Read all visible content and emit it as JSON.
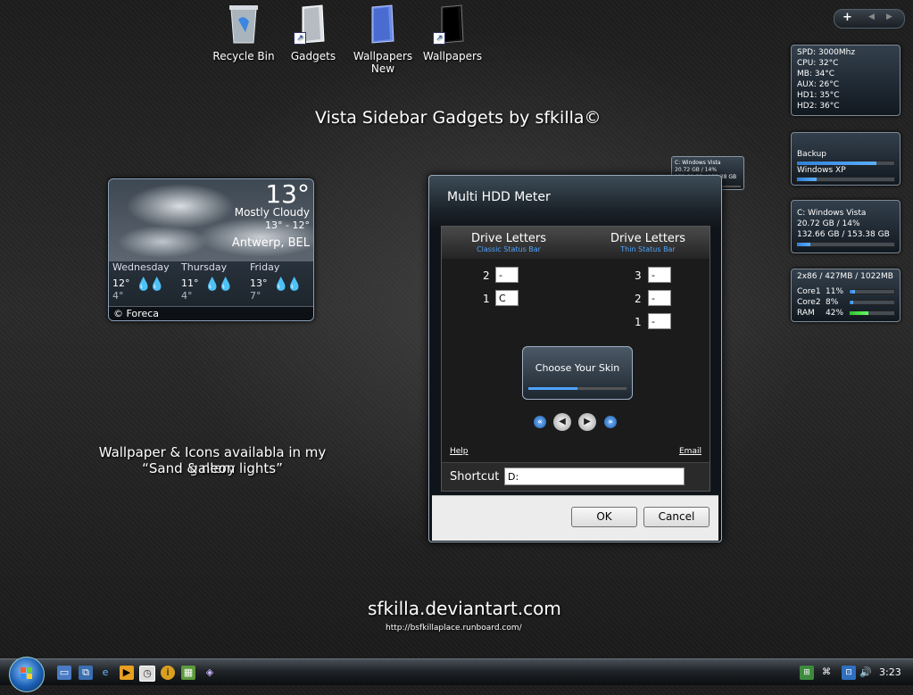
{
  "desktop_icons": [
    {
      "label": "Recycle Bin",
      "icon": "recycle-bin-icon"
    },
    {
      "label": "Gadgets",
      "icon": "folder-shortcut-icon"
    },
    {
      "label": "Wallpapers New",
      "icon": "folder-icon"
    },
    {
      "label": "Wallpapers",
      "icon": "folder-shortcut-icon"
    }
  ],
  "wallpaper": {
    "heading": "Vista Sidebar Gadgets by sfkilla©",
    "gallery_line1": "Wallpaper & Icons availabla in my gallery",
    "gallery_line2": "“Sand & neon lights”",
    "site": "sfkilla.deviantart.com",
    "url": "http://bsfkillaplace.runboard.com/"
  },
  "weather": {
    "temp": "13°",
    "condition": "Mostly Cloudy",
    "range": "13° - 12°",
    "city": "Antwerp, BEL",
    "days": [
      {
        "name": "Wednesday",
        "hi": "12°",
        "lo": "4°"
      },
      {
        "name": "Thursday",
        "hi": "11°",
        "lo": "4°"
      },
      {
        "name": "Friday",
        "hi": "13°",
        "lo": "7°"
      }
    ],
    "footer": "© Foreca"
  },
  "dialog": {
    "title": "Multi HDD Meter",
    "left_heading": "Drive Letters",
    "left_sub": "Classic Status Bar",
    "right_heading": "Drive Letters",
    "right_sub": "Thin Status Bar",
    "left_rows": [
      {
        "num": "2",
        "value": "-"
      },
      {
        "num": "1",
        "value": "C"
      }
    ],
    "right_rows": [
      {
        "num": "3",
        "value": "-"
      },
      {
        "num": "2",
        "value": "-"
      },
      {
        "num": "1",
        "value": "-"
      }
    ],
    "skin_button": "Choose Your Skin",
    "help": "Help",
    "email": "Email",
    "shortcut_label": "Shortcut",
    "shortcut_value": "D:",
    "ok": "OK",
    "cancel": "Cancel"
  },
  "mini_hdd": {
    "line1": "C: Windows Vista",
    "line2": "20.72 GB / 14%",
    "line3": "132.66 GB / 153.38 GB"
  },
  "sidebar": {
    "temps": [
      "SPD: 3000Mhz",
      "CPU:  32°C",
      "MB:   34°C",
      "AUX:  26°C",
      "HD1:  35°C",
      "HD2:  36°C"
    ],
    "backup_label": "Backup",
    "xp_label": "Windows XP",
    "vista_lines": [
      "C: Windows Vista",
      "20.72 GB / 14%",
      "132.66 GB / 153.38 GB"
    ],
    "cpu_header": "2x86 / 427MB / 1022MB",
    "cpu_rows": [
      {
        "name": "Core1",
        "pct": "11%"
      },
      {
        "name": "Core2",
        "pct": "8%"
      },
      {
        "name": "RAM",
        "pct": "42%"
      }
    ]
  },
  "taskbar": {
    "clock": "3:23"
  },
  "colors": {
    "accent_blue": "#4fa3ff",
    "bar_green": "#44dd44"
  }
}
